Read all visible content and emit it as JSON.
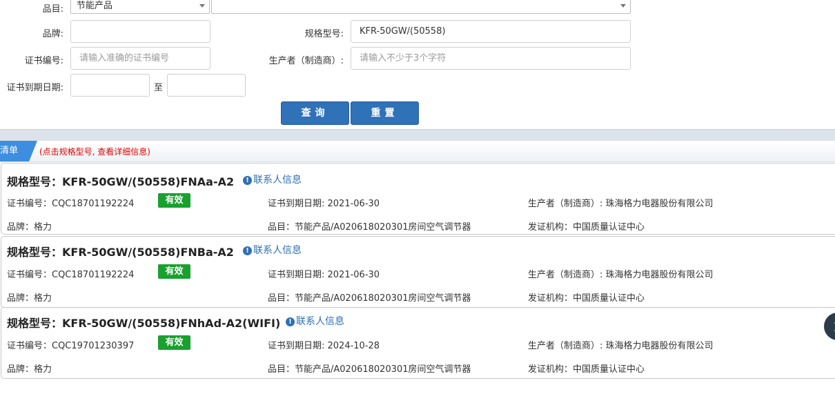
{
  "form": {
    "category_label": "品目:",
    "category_value": "节能产品",
    "subcategory_value": "",
    "brand_label": "品牌:",
    "brand_value": "",
    "model_label": "规格型号:",
    "model_value": "KFR-50GW/(50558)",
    "cert_label": "证书编号:",
    "cert_placeholder": "请输入准确的证书编号",
    "maker_label": "生产者（制造商）:",
    "maker_placeholder": "请输入不少于3个字符",
    "expiry_label": "证书到期日期:",
    "expiry_from": "",
    "expiry_sep": "至",
    "expiry_to": "",
    "query_button": "查询",
    "reset_button": "重置"
  },
  "list": {
    "tab_label": "清单",
    "hint": "(点击规格型号, 查看详细信息)"
  },
  "colors": {
    "accent": "#2f72b8",
    "valid": "#1aa02f",
    "hint": "#e60000"
  },
  "results": [
    {
      "model": "规格型号：KFR-50GW/(50558)FNAa-A2",
      "contact": "联系人信息",
      "cert_no": "证书编号：CQC18701192224",
      "status": "有效",
      "expiry": "证书到期日期: 2021-06-30",
      "maker": "生产者（制造商）: 珠海格力电器股份有限公司",
      "brand": "品牌：格力",
      "category": "品目：节能产品/A020618020301房间空气调节器",
      "issuer": "发证机构：中国质量认证中心"
    },
    {
      "model": "规格型号：KFR-50GW/(50558)FNBa-A2",
      "contact": "联系人信息",
      "cert_no": "证书编号：CQC18701192224",
      "status": "有效",
      "expiry": "证书到期日期: 2021-06-30",
      "maker": "生产者（制造商）: 珠海格力电器股份有限公司",
      "brand": "品牌：格力",
      "category": "品目：节能产品/A020618020301房间空气调节器",
      "issuer": "发证机构：中国质量认证中心"
    },
    {
      "model": "规格型号：KFR-50GW/(50558)FNhAd-A2(WIFI)",
      "contact": "联系人信息",
      "cert_no": "证书编号：CQC19701230397",
      "status": "有效",
      "expiry": "证书到期日期: 2024-10-28",
      "maker": "生产者（制造商）: 珠海格力电器股份有限公司",
      "brand": "品牌：格力",
      "category": "品目：节能产品/A020618020301房间空气调节器",
      "issuer": "发证机构：中国质量认证中心"
    }
  ]
}
